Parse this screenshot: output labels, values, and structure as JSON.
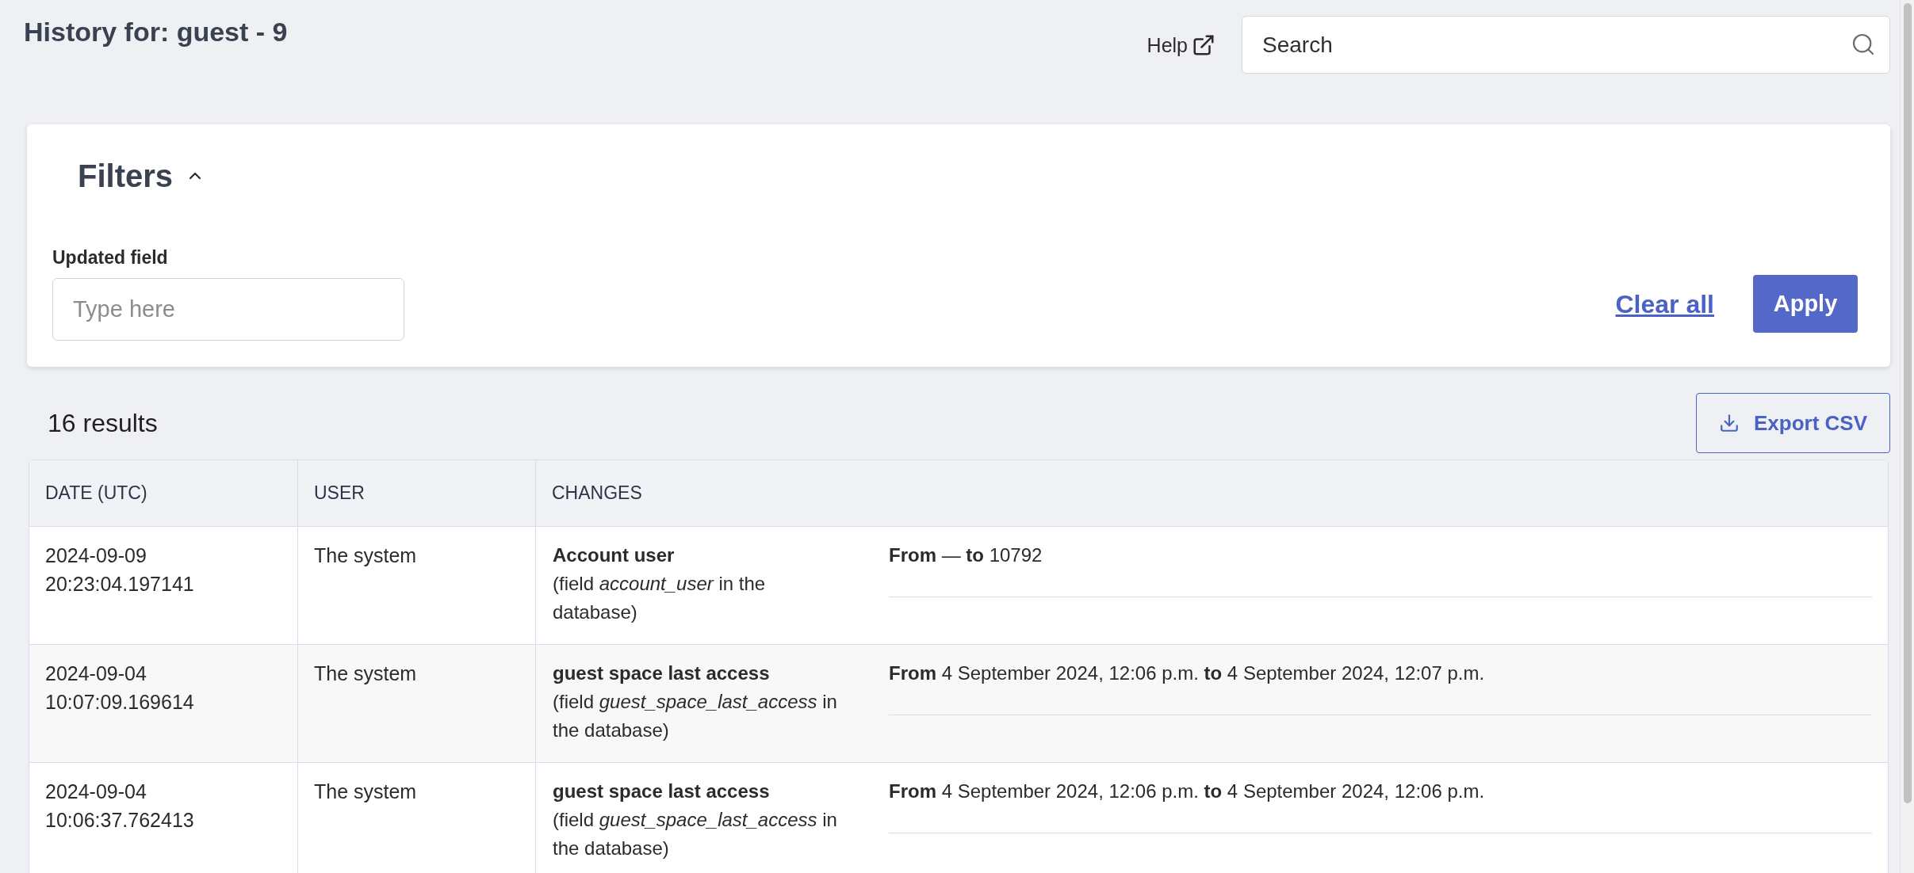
{
  "header": {
    "title": "History for: guest - 9",
    "help_link": "Help",
    "search": {
      "placeholder": "Search"
    }
  },
  "filters": {
    "title": "Filters",
    "expanded": true,
    "fields": [
      {
        "label": "Updated field",
        "placeholder": "Type here"
      }
    ],
    "clear_all": "Clear all",
    "apply": "Apply"
  },
  "results": {
    "count": "16 results",
    "export_button": "Export CSV"
  },
  "table": {
    "columns": [
      "DATE (UTC)",
      "USER",
      "CHANGES"
    ],
    "rows": [
      {
        "date": "2024-09-09 20:23:04.197141",
        "user": "The system",
        "field": "Account user",
        "field_note": "(field *account_user* in the database)",
        "change": "**From** — **to** 10792"
      },
      {
        "date": "2024-09-04 10:07:09.169614",
        "user": "The system",
        "field": "guest space last access",
        "field_note": "(field *guest_space_last_access* in the database)",
        "change": "**From** 4 September 2024, 12:06 p.m. **to** 4 September 2024, 12:07 p.m."
      },
      {
        "date": "2024-09-04 10:06:37.762413",
        "user": "The system",
        "field": "guest space last access",
        "field_note": "(field *guest_space_last_access* in the database)",
        "change": "**From** 4 September 2024, 12:06 p.m. **to** 4 September 2024, 12:06 p.m."
      }
    ]
  }
}
